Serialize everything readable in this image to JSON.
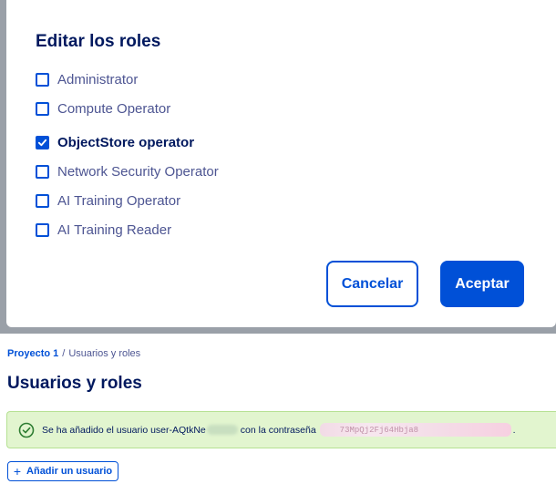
{
  "modal": {
    "title": "Editar los roles",
    "roles": [
      {
        "label": "Administrator",
        "checked": false
      },
      {
        "label": "Compute Operator",
        "checked": false
      },
      {
        "label": "ObjectStore operator",
        "checked": true
      },
      {
        "label": "Network Security Operator",
        "checked": false
      },
      {
        "label": "AI Training Operator",
        "checked": false
      },
      {
        "label": "AI Training Reader",
        "checked": false
      }
    ],
    "cancel_label": "Cancelar",
    "accept_label": "Aceptar"
  },
  "breadcrumb": {
    "project": "Proyecto 1",
    "separator": "/",
    "current": "Usuarios y roles"
  },
  "page": {
    "title": "Usuarios y roles"
  },
  "alert": {
    "prefix": "Se ha añadido el usuario user-AQtkNe",
    "middle": "con la contraseña",
    "password_visible": "73MpQj2Fj64Hbja8",
    "suffix": "."
  },
  "actions": {
    "add_user_label": "Añadir un usuario",
    "add_user_icon": "plus-icon"
  },
  "colors": {
    "primary": "#0050d7",
    "text_dark": "#00185e",
    "success_bg": "#e2f5cf",
    "overlay": "#9aa0a8"
  }
}
